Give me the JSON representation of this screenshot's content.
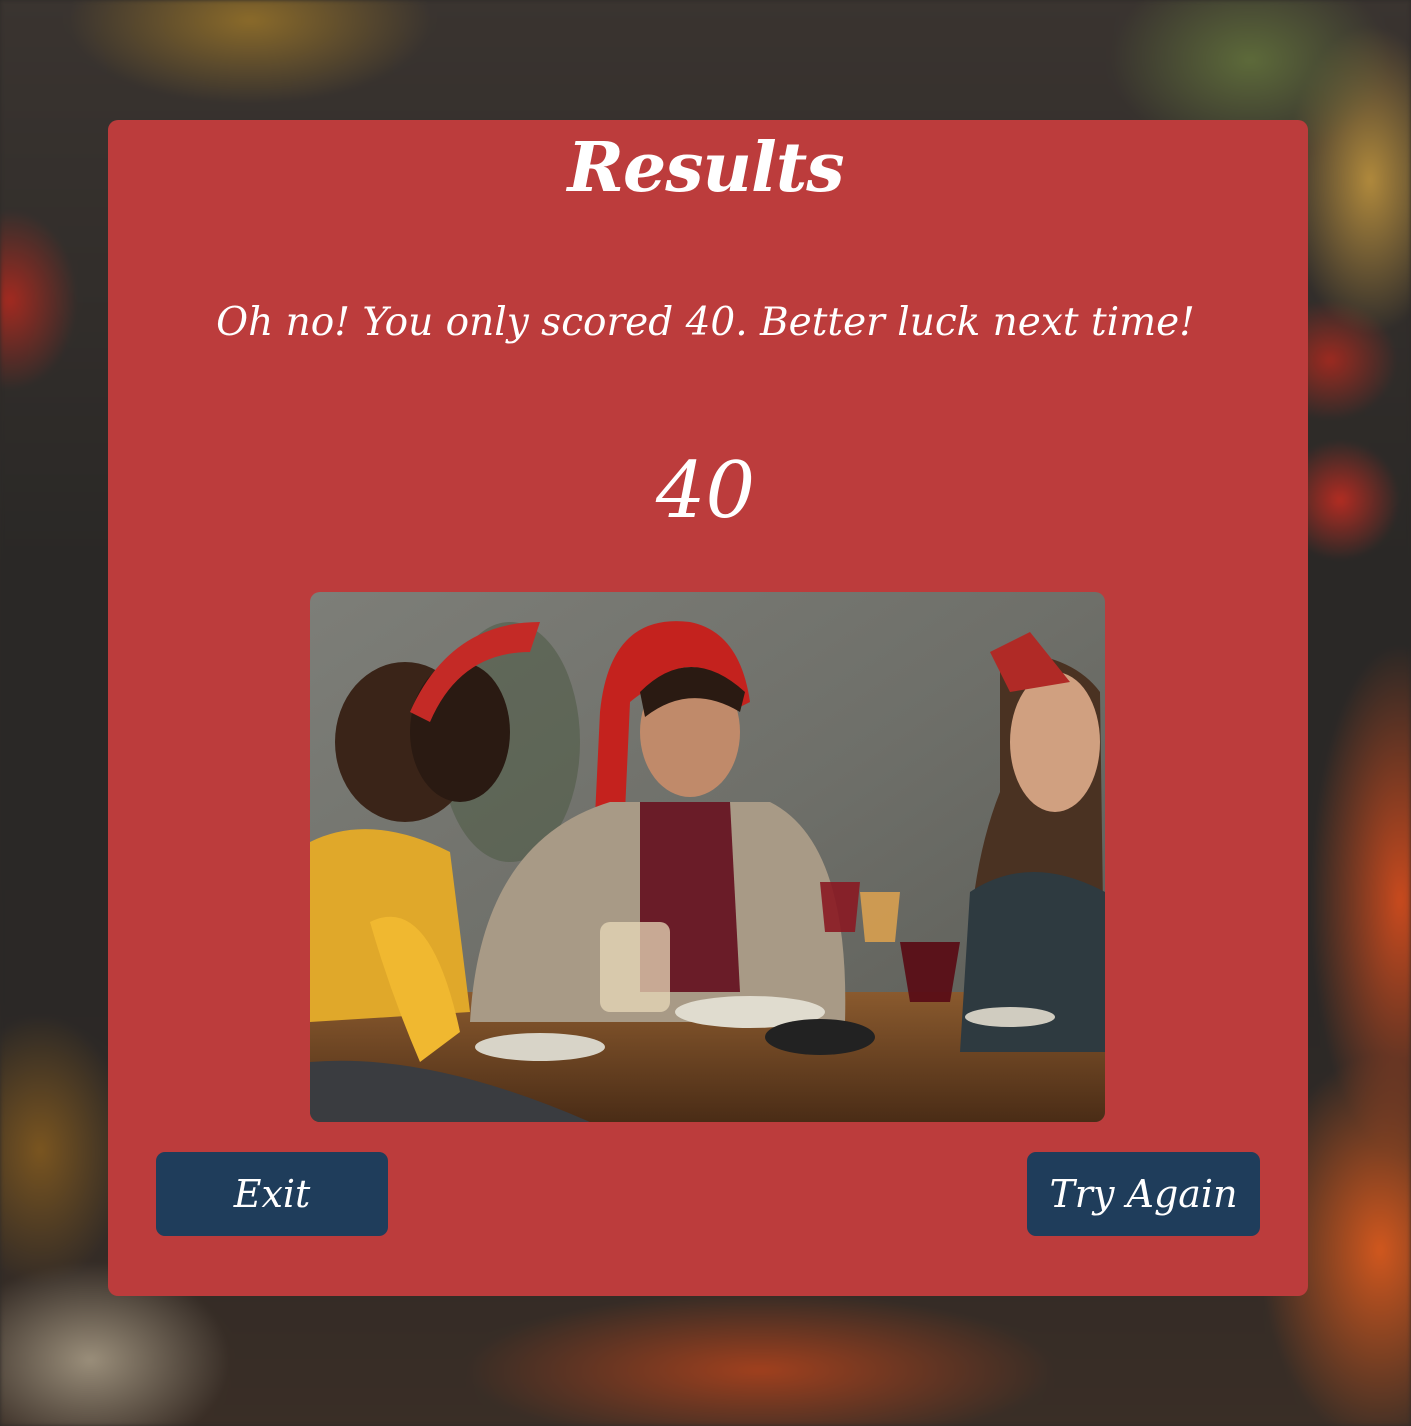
{
  "results": {
    "title": "Results",
    "message": "Oh no! You only scored 40. Better luck next time!",
    "score": "40"
  },
  "buttons": {
    "exit_label": "Exit",
    "try_again_label": "Try Again"
  },
  "colors": {
    "card": "#bc3c3c",
    "button": "#1f3d5b",
    "text": "#ffffff"
  }
}
